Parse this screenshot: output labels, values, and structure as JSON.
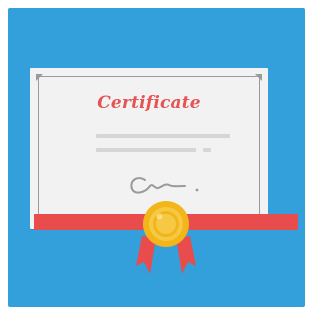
{
  "certificate": {
    "title": "Certificate"
  },
  "colors": {
    "background_outer": "#ffffff",
    "panel": "#33a0dc",
    "paper": "#f2f2f2",
    "border": "#9a9a9a",
    "text_lines": "#d6d6d6",
    "title": "#e55353",
    "ribbon": "#e84c4c",
    "seal_outer": "#f2b61b",
    "seal_inner": "#f6c843",
    "seal_tails": "#e84c4c"
  },
  "icons": {
    "signature": "signature-icon",
    "seal": "award-seal-icon",
    "ribbon": "ribbon-icon"
  }
}
